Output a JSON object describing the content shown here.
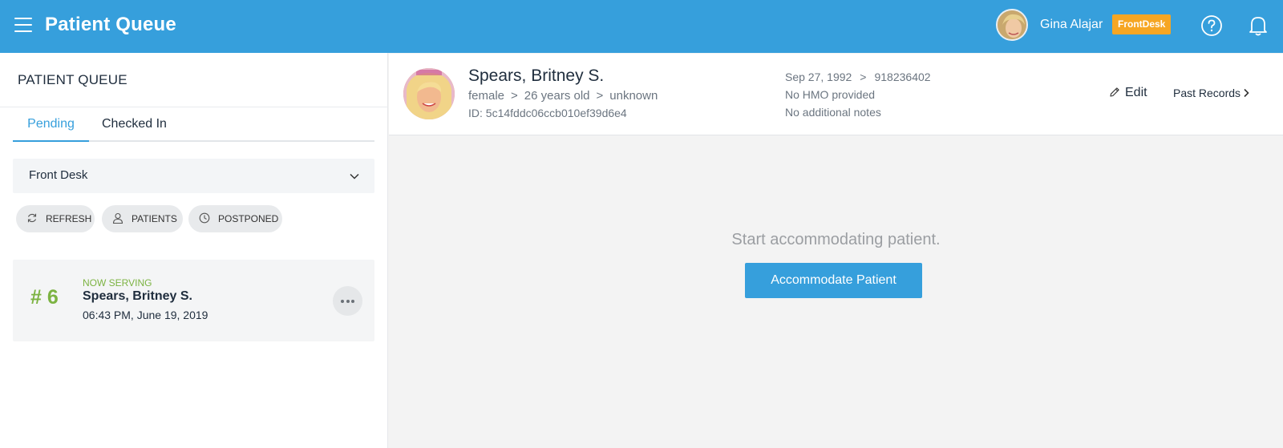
{
  "header": {
    "title": "Patient Queue",
    "user_name": "Gina Alajar",
    "role": "FrontDesk",
    "accent": "#369fdc",
    "badge_color": "#f6a623"
  },
  "sidebar": {
    "title": "PATIENT QUEUE",
    "tabs": [
      {
        "label": "Pending",
        "active": true
      },
      {
        "label": "Checked In",
        "active": false
      }
    ],
    "department": "Front Desk",
    "actions": [
      {
        "label": "REFRESH",
        "icon": "refresh-icon"
      },
      {
        "label": "PATIENTS",
        "icon": "user-icon"
      },
      {
        "label": "POSTPONED",
        "icon": "clock-icon"
      }
    ],
    "queue": [
      {
        "number": "# 6",
        "status": "NOW SERVING",
        "name": "Spears, Britney S.",
        "time": "06:43 PM, June 19, 2019"
      }
    ]
  },
  "patient": {
    "name": "Spears, Britney S.",
    "gender": "female",
    "age": "26 years old",
    "blood": "unknown",
    "id_text": "ID: 5c14fddc06ccb010ef39d6e4",
    "birthdate": "Sep 27, 1992",
    "phone": "918236402",
    "hmo": "No HMO provided",
    "notes": "No additional notes",
    "edit_label": "Edit",
    "past_label": "Past Records"
  },
  "main": {
    "empty_message": "Start accommodating patient.",
    "button_label": "Accommodate Patient"
  }
}
